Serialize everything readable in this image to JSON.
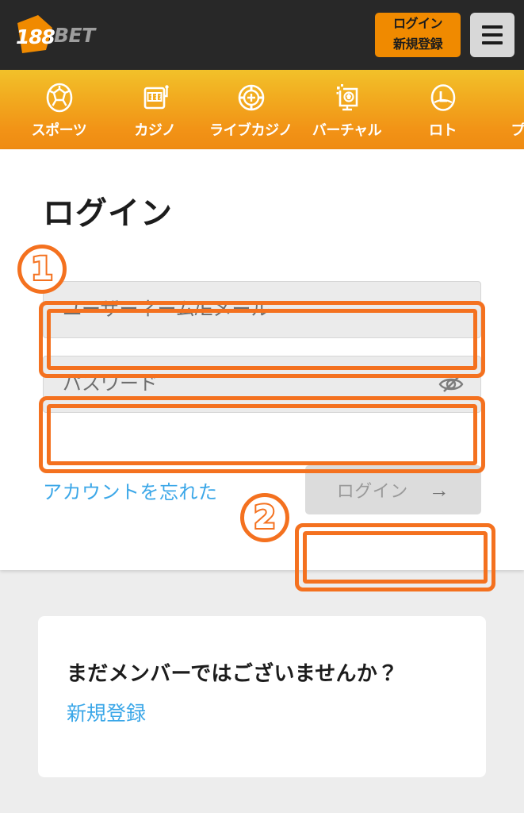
{
  "header": {
    "logo": {
      "primary": "188",
      "secondary": "BET",
      "badge_color": "#f08a00",
      "primary_color": "#ffffff",
      "secondary_color": "#9e9e9e"
    },
    "auth_button": {
      "login_label": "ログイン",
      "register_label": "新規登録",
      "background": "#f08a00"
    },
    "menu_button_label": "menu",
    "background": "#282828"
  },
  "nav": {
    "items": [
      {
        "label": "スポーツ",
        "icon": "soccer-ball-icon"
      },
      {
        "label": "カジノ",
        "icon": "slot-machine-icon"
      },
      {
        "label": "ライブカジノ",
        "icon": "casino-chip-icon"
      },
      {
        "label": "バーチャル",
        "icon": "virtual-monitor-icon"
      },
      {
        "label": "ロト",
        "icon": "lotto-icon"
      },
      {
        "label": "プロモー",
        "icon": "gift-icon"
      }
    ],
    "gradient_top": "#f2c12a",
    "gradient_bottom": "#ef8b12"
  },
  "login": {
    "title": "ログイン",
    "username": {
      "placeholder": "ユーザーネーム/Eメール",
      "value": ""
    },
    "password": {
      "placeholder": "パスワード",
      "value": "",
      "toggle_icon": "eye-off-icon"
    },
    "forgot_link": "アカウントを忘れた",
    "submit": {
      "label": "ログイン",
      "arrow": "→",
      "disabled": true,
      "background": "#dcdcdc",
      "text_color": "#9a9a9a"
    }
  },
  "signup_card": {
    "title": "まだメンバーではございませんか？",
    "link": "新規登録",
    "link_color": "#3ba7e8"
  },
  "annotations": {
    "accent_color": "#f4711f",
    "markers": [
      {
        "digit": "1",
        "target": "username-field"
      },
      {
        "digit": "2",
        "target": "login-submit-button"
      }
    ]
  }
}
